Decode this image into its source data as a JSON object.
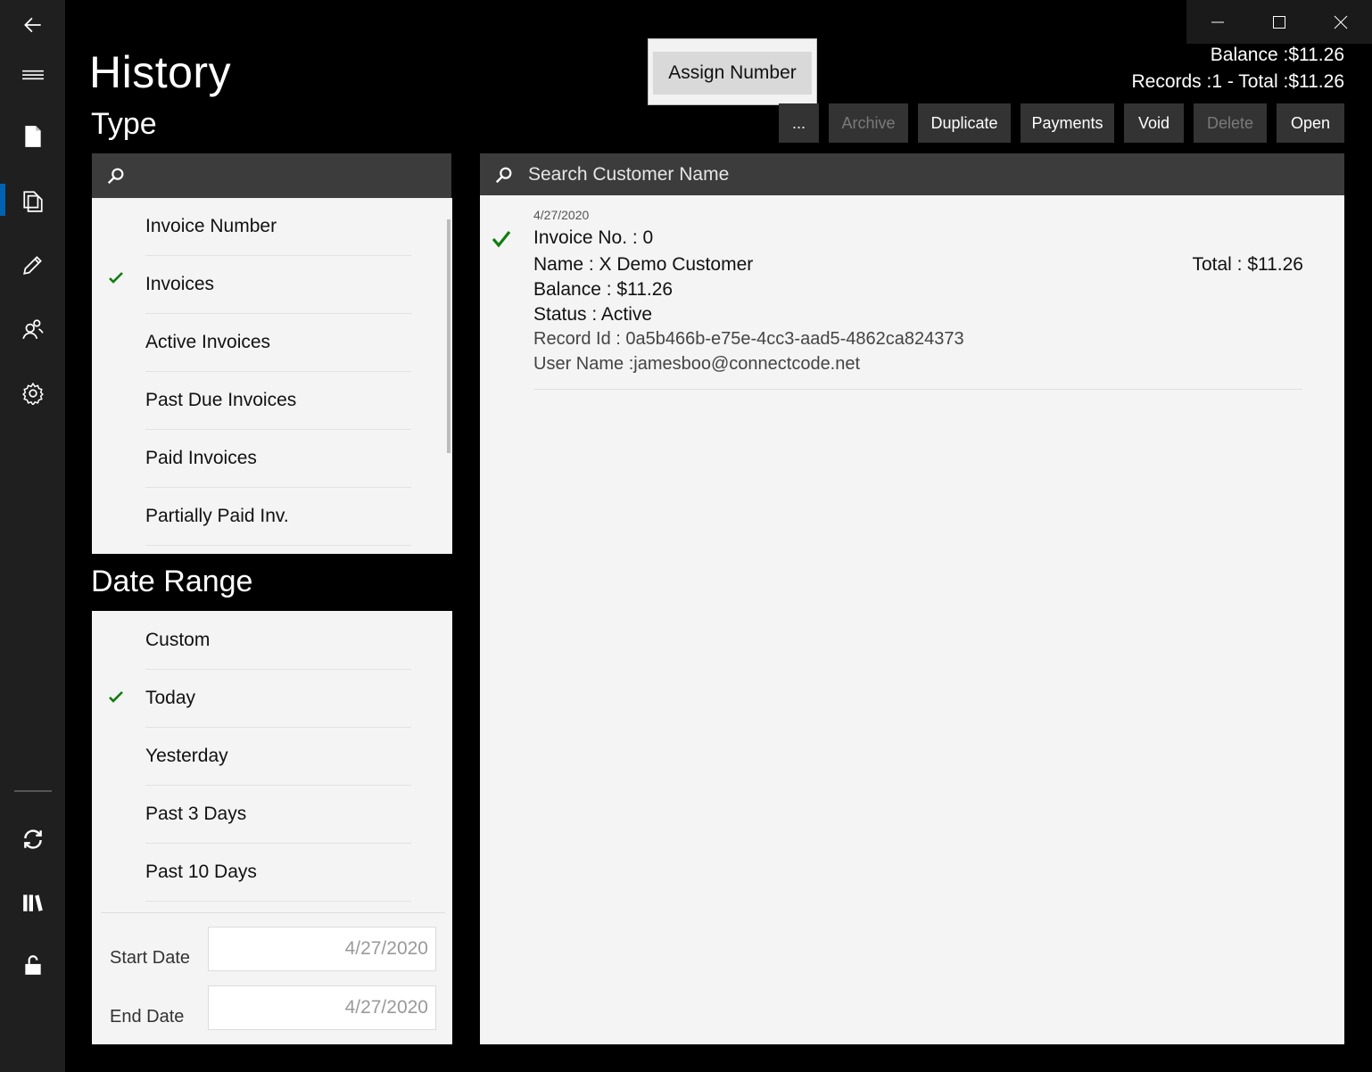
{
  "page": {
    "title": "History",
    "type_heading": "Type",
    "date_range_heading": "Date Range"
  },
  "assign_button": {
    "label": "Assign Number"
  },
  "summary": {
    "balance": "Balance :$11.26",
    "records": "Records :1 - Total :$11.26"
  },
  "toolbar": {
    "more": "...",
    "archive": "Archive",
    "duplicate": "Duplicate",
    "payments": "Payments",
    "void": "Void",
    "delete": "Delete",
    "open": "Open"
  },
  "type_search": {
    "placeholder": ""
  },
  "customer_search": {
    "placeholder": "Search Customer Name"
  },
  "type_options": [
    {
      "label": "Invoice Number",
      "checked": false
    },
    {
      "label": "Invoices",
      "checked": true
    },
    {
      "label": "Active Invoices",
      "checked": false
    },
    {
      "label": "Past Due Invoices",
      "checked": false
    },
    {
      "label": "Paid Invoices",
      "checked": false
    },
    {
      "label": "Partially Paid Inv.",
      "checked": false
    }
  ],
  "date_options": [
    {
      "label": "Custom",
      "checked": false
    },
    {
      "label": "Today",
      "checked": true
    },
    {
      "label": "Yesterday",
      "checked": false
    },
    {
      "label": "Past 3 Days",
      "checked": false
    },
    {
      "label": "Past 10 Days",
      "checked": false
    }
  ],
  "dates": {
    "start_label": "Start Date",
    "start_value": "4/27/2020",
    "end_label": "End Date",
    "end_value": "4/27/2020"
  },
  "record": {
    "date": "4/27/2020",
    "invoice_no": "Invoice No. : 0",
    "name": "Name : X Demo Customer",
    "total": "Total : $11.26",
    "balance": "Balance : $11.26",
    "status": "Status :  Active",
    "record_id": "Record Id : 0a5b466b-e75e-4cc3-aad5-4862ca824373",
    "user_name": "User Name :jamesboo@connectcode.net"
  },
  "colors": {
    "accent": "#0063b1",
    "check_green": "#107c10",
    "panel_bg": "#f4f4f4",
    "toolbar_bg": "#333333"
  },
  "icons": {
    "rail": [
      "back-arrow-icon",
      "hamburger-menu-icon",
      "document-icon",
      "copy-documents-icon",
      "pencil-icon",
      "people-icon",
      "gear-icon",
      "sync-icon",
      "library-icon",
      "unlock-icon"
    ],
    "window": [
      "minimize-icon",
      "maximize-icon",
      "close-icon"
    ]
  }
}
